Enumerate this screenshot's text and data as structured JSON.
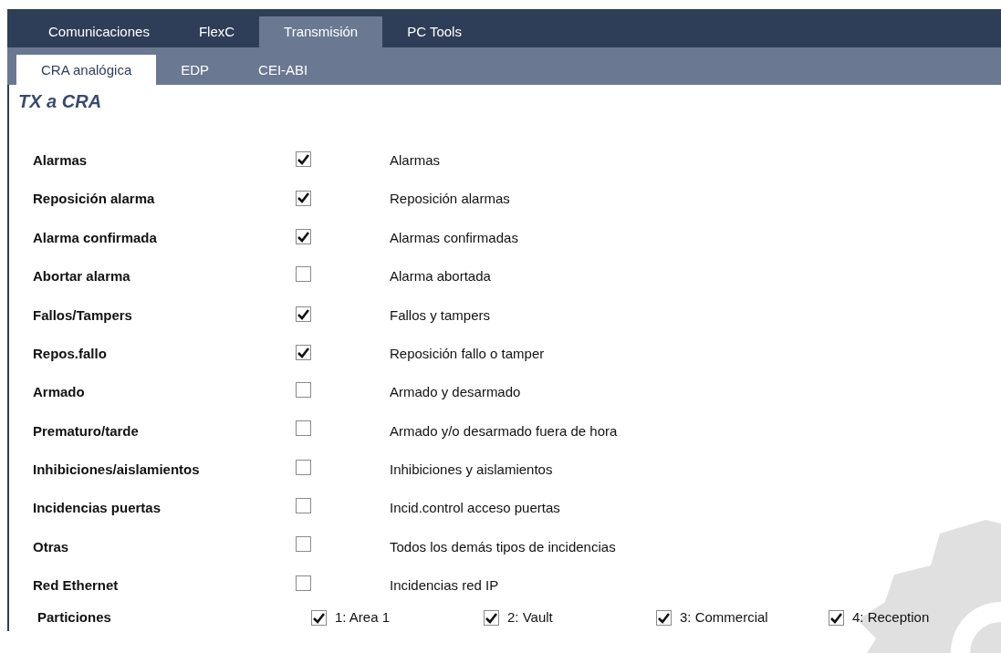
{
  "tabs": [
    {
      "label": "Comunicaciones",
      "selected": false
    },
    {
      "label": "FlexC",
      "selected": false
    },
    {
      "label": "Transmisión",
      "selected": true
    },
    {
      "label": "PC Tools",
      "selected": false
    }
  ],
  "subtabs": [
    {
      "label": "CRA analógica",
      "selected": true
    },
    {
      "label": "EDP",
      "selected": false
    },
    {
      "label": "CEI-ABI",
      "selected": false
    }
  ],
  "title": "TX a CRA",
  "rows": [
    {
      "label": "Alarmas",
      "checked": true,
      "description": "Alarmas"
    },
    {
      "label": "Reposición alarma",
      "checked": true,
      "description": "Reposición alarmas"
    },
    {
      "label": "Alarma confirmada",
      "checked": true,
      "description": "Alarmas confirmadas"
    },
    {
      "label": "Abortar alarma",
      "checked": false,
      "description": "Alarma abortada"
    },
    {
      "label": "Fallos/Tampers",
      "checked": true,
      "description": "Fallos y tampers"
    },
    {
      "label": "Repos.fallo",
      "checked": true,
      "description": "Reposición fallo o tamper"
    },
    {
      "label": "Armado",
      "checked": false,
      "description": "Armado y desarmado"
    },
    {
      "label": "Prematuro/tarde",
      "checked": false,
      "description": "Armado y/o desarmado fuera de hora"
    },
    {
      "label": "Inhibiciones/aislamientos",
      "checked": false,
      "description": "Inhibiciones y aislamientos"
    },
    {
      "label": "Incidencias puertas",
      "checked": false,
      "description": "Incid.control acceso puertas"
    },
    {
      "label": "Otras",
      "checked": false,
      "description": "Todos los demás tipos de incidencias"
    },
    {
      "label": "Red Ethernet",
      "checked": false,
      "description": "Incidencias red IP"
    }
  ],
  "partitions": {
    "label": "Particiones",
    "items": [
      {
        "label": "1: Area 1",
        "checked": true
      },
      {
        "label": "2: Vault",
        "checked": true
      },
      {
        "label": "3: Commercial",
        "checked": true
      },
      {
        "label": "4: Reception",
        "checked": true
      }
    ]
  }
}
